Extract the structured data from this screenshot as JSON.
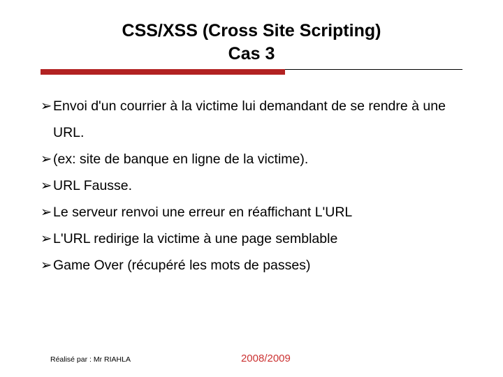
{
  "title_line1": "CSS/XSS (Cross Site Scripting)",
  "title_line2": "Cas 3",
  "bullets": [
    "Envoi d'un courrier à la victime lui demandant de se rendre à une URL.",
    " (ex: site de banque en ligne de la victime).",
    "URL Fausse.",
    "Le serveur renvoi une erreur en réaffichant L'URL",
    "L'URL redirige la victime à une page semblable",
    "Game Over (récupéré les mots de passes)"
  ],
  "footer": {
    "author": "Réalisé par :  Mr RIAHLA",
    "year": "2008/2009"
  },
  "glyphs": {
    "arrow": "➢"
  }
}
